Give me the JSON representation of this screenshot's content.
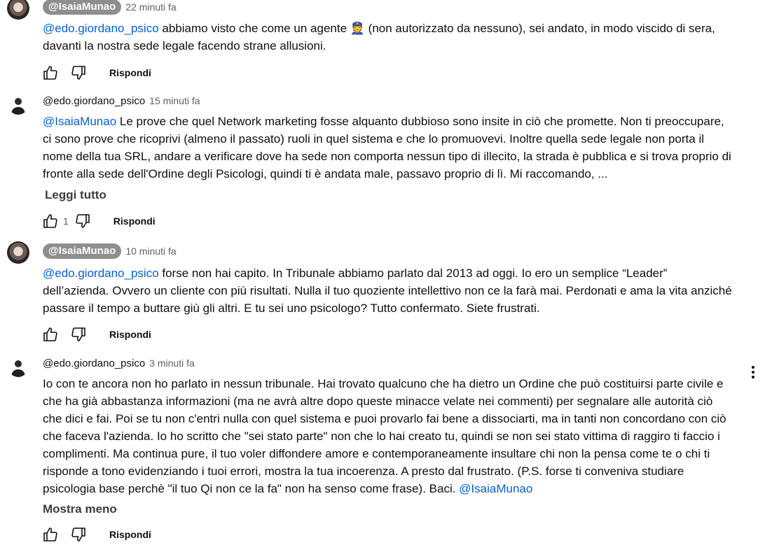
{
  "comments": [
    {
      "author": "@IsaiaMunao",
      "time": "22 minuti fa",
      "mention": "@edo.giordano_psico",
      "text_a": " abbiamo visto che come un agente ",
      "emoji": "👮",
      "text_b": " (non autorizzato da nessuno), sei andato, in modo viscido di sera, davanti la nostra sede legale facendo strane allusioni.",
      "reply": "Rispondi"
    },
    {
      "author": "@edo.giordano_psico",
      "time": "15 minuti fa",
      "mention": "@IsaiaMunao",
      "text": " Le prove che quel Network marketing fosse alquanto dubbioso sono insite in ciò che promette. Non ti preoccupare, ci sono prove che ricoprivi (almeno il passato) ruoli in quel sistema e che lo promuovevi. Inoltre quella sede legale non porta il nome della tua SRL, andare a verificare dove ha sede non comporta nessun tipo di illecito, la strada è pubblica e si trova proprio di fronte alla sede dell'Ordine degli Psicologi, quindi ti è andata male, passavo proprio di lì.  Mi raccomando, ...",
      "read_more": "Leggi tutto",
      "likes": "1",
      "reply": "Rispondi"
    },
    {
      "author": "@IsaiaMunao",
      "time": "10 minuti fa",
      "mention": "@edo.giordano_psico",
      "text": " forse non hai capito. In Tribunale abbiamo parlato dal 2013 ad oggi. Io ero un semplice “Leader” dell’azienda. Ovvero un cliente con più risultati. Nulla il tuo quoziente intellettivo non ce la farà mai. Perdonati e ama la vita anziché passare il tempo a buttare giù gli altri. E tu sei uno psicologo? Tutto confermato. Siete frustrati.",
      "reply": "Rispondi"
    },
    {
      "author": "@edo.giordano_psico",
      "time": "3 minuti fa",
      "text": "Io con te ancora non ho parlato in nessun tribunale. Hai trovato qualcuno che ha dietro un Ordine che può costituirsi parte civile e che ha già abbastanza informazioni (ma ne avrà altre dopo queste minacce velate nei commenti) per segnalare alle autorità ciò che dici e fai. Poi se tu non c'entri nulla con quel sistema e puoi provarlo fai bene a dissociarti, ma in tanti non concordano con ciò che faceva l'azienda. Io ho scritto che \"sei stato parte\" non che lo hai creato tu, quindi se non sei stato vittima di raggiro ti faccio i complimenti. Ma continua pure, il tuo voler diffondere amore e contemporaneamente insultare chi non la pensa come te o chi ti risponde a tono evidenziando i tuoi errori, mostra la tua incoerenza. A presto dal frustrato. (P.S. forse ti conveniva studiare psicologia base perchè \"il tuo Qi non ce la fa\" non ha senso come frase). Baci. ",
      "mention": "@IsaiaMunao",
      "show_less": "Mostra meno",
      "reply": "Rispondi"
    }
  ],
  "icons": {
    "like": "thumb-up-icon",
    "dislike": "thumb-down-icon",
    "menu": "more-vert-icon"
  },
  "colors": {
    "mention": "#065fd4",
    "author_chip": "#8e8e8e",
    "secondary_text": "#606060"
  }
}
